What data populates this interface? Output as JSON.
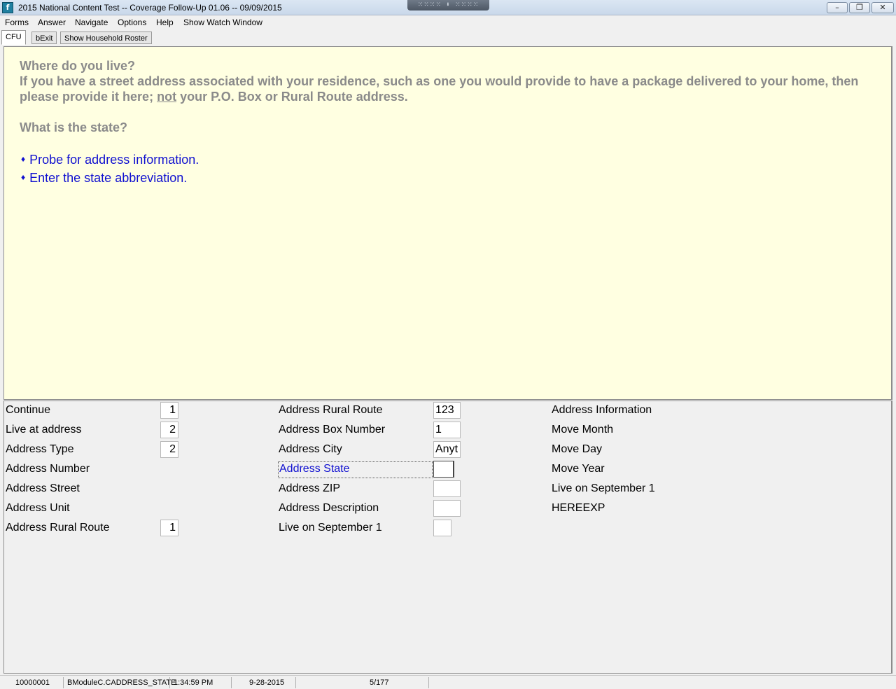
{
  "window": {
    "title": "2015 National Content Test -- Coverage Follow-Up 01.06 -- 09/09/2015",
    "app_icon": "app-icon",
    "min_glyph": "–",
    "max_glyph": "❐",
    "close_glyph": "✕",
    "dock_handle_glyph": "⁙⁙⁙⁙ ⬇ ⁙⁙⁙⁙"
  },
  "menu": {
    "items": [
      "Forms",
      "Answer",
      "Navigate",
      "Options",
      "Help",
      "Show Watch Window"
    ]
  },
  "tabs": [
    {
      "label": "CFU",
      "active": true
    },
    {
      "label": "bExit",
      "active": false
    },
    {
      "label": "Show Household Roster",
      "active": false
    }
  ],
  "question": {
    "line1": "Where do you live?",
    "line2_before": "If you have a street address associated with your residence, such as one you would provide to have a package delivered to your home, then please provide it here; ",
    "line2_underlined": "not",
    "line2_after": " your P.O. Box or Rural Route address.",
    "state_question": "What is the state?",
    "instructions": [
      "Probe for address information.",
      "Enter the state abbreviation."
    ],
    "bullet_glyph": "♦"
  },
  "fields": {
    "col1": [
      {
        "label": "Continue",
        "value": "1"
      },
      {
        "label": "Live at address",
        "value": "2"
      },
      {
        "label": "Address Type",
        "value": "2"
      },
      {
        "label": "Address Number",
        "value": null
      },
      {
        "label": "Address Street",
        "value": null
      },
      {
        "label": "Address Unit",
        "value": null
      },
      {
        "label": "Address Rural Route",
        "value": "1"
      }
    ],
    "col2": [
      {
        "label": "Address Rural Route",
        "value": "123"
      },
      {
        "label": "Address Box Number",
        "value": "1"
      },
      {
        "label": "Address City",
        "value": "Anyt"
      },
      {
        "label": "Address State",
        "value": "",
        "active": true
      },
      {
        "label": "Address ZIP",
        "value": ""
      },
      {
        "label": "Address Description",
        "value": ""
      },
      {
        "label": "Live on September 1",
        "value": ""
      }
    ],
    "col3": [
      {
        "label": "Address Information"
      },
      {
        "label": "Move Month"
      },
      {
        "label": "Move Day"
      },
      {
        "label": "Move Year"
      },
      {
        "label": "Live on September 1"
      },
      {
        "label": "HEREEXP"
      }
    ]
  },
  "status": {
    "case_id": "10000001",
    "field_path": "BModuleC.CADDRESS_STATE",
    "time": "1:34:59 PM",
    "date": "9-28-2015",
    "page": "5/177"
  }
}
